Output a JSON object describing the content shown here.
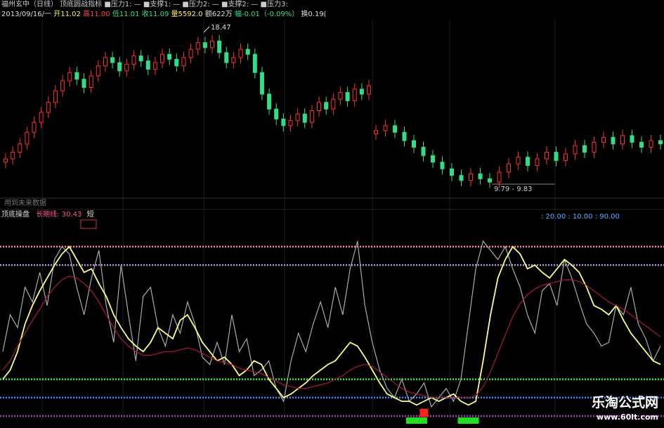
{
  "header": {
    "row1": "福州玄中（日线） 顶底圆战指标 ■压力1: — ■支撑1: — ■压力2: — ■支撑2: — ■压力3:",
    "row2": {
      "date": "2013/09/16/一",
      "open": "开11.02",
      "high": "高11.00",
      "low": "低11.01",
      "close": "收11.09",
      "volume": "量5592.0",
      "amount": "额622万",
      "change": "幅-0.01（-0.09%）",
      "turnover": "换0.19("
    }
  },
  "future_label": "用到未来数据",
  "indicator_header": {
    "name": "顶底操盘",
    "param_label": "长期线: 30.43",
    "short_label": "短",
    "levels_text": ": 20.00 : 10.00 : 90.00"
  },
  "colors": {
    "up": "#ff3030",
    "down": "#33dd88",
    "yellow": "#ffff88",
    "gray": "#aaaaaa",
    "maroon": "#aa1a3a",
    "pink": "#ff88aa",
    "lavender": "#bb99dd",
    "green": "#33ee33",
    "blue": "#4488ff",
    "purple": "#bb33cc"
  },
  "chart_data": [
    {
      "type": "candlestick",
      "annotations": [
        {
          "label": "18.47",
          "kind": "high"
        },
        {
          "label": "9.79 - 9.83",
          "kind": "range"
        }
      ],
      "segments": [
        {
          "name": "",
          "prices": [
            11.2,
            11.6,
            12.1,
            12.8,
            13.4,
            14.0,
            14.6,
            15.3,
            15.9,
            16.4,
            16.0,
            15.5,
            16.2,
            16.8,
            17.3,
            17.0,
            16.5,
            16.9,
            17.4,
            17.1,
            16.6,
            17.0,
            17.5,
            17.2,
            16.8,
            17.3,
            17.8,
            18.2,
            17.9,
            18.3,
            17.6,
            17.0,
            17.3,
            17.8,
            17.5,
            16.4,
            15.1,
            14.2,
            13.6,
            13.2,
            13.5,
            13.9,
            13.4,
            14.1,
            14.6,
            14.2,
            14.8,
            15.2,
            14.7,
            15.4,
            15.1,
            15.6
          ]
        },
        {
          "name": "",
          "prices": [
            12.9,
            13.2,
            12.8,
            12.3,
            11.9,
            11.4,
            11.0,
            10.6,
            10.2,
            9.9,
            10.3,
            10.0,
            9.8,
            10.4,
            10.9,
            11.3,
            10.8,
            11.2,
            11.6,
            11.1,
            11.5,
            12.0,
            11.6,
            12.2,
            12.5,
            12.1,
            12.6,
            12.2,
            11.9,
            12.3,
            12.1
          ]
        }
      ]
    },
    {
      "type": "line",
      "ylim": [
        0,
        100
      ],
      "hlines": [
        {
          "value": 92,
          "color": "#ff88aa"
        },
        {
          "value": 82,
          "color": "#bb99dd"
        },
        {
          "value": 20,
          "color": "#33ee33"
        },
        {
          "value": 10,
          "color": "#4488ff"
        },
        {
          "value": 0,
          "color": "#bb33cc"
        }
      ],
      "series": [
        {
          "name": "",
          "color": "#aaaaaa",
          "values": [
            35,
            55,
            48,
            70,
            62,
            78,
            60,
            85,
            92,
            88,
            70,
            55,
            75,
            90,
            60,
            40,
            82,
            55,
            30,
            65,
            70,
            48,
            38,
            55,
            45,
            62,
            50,
            32,
            28,
            40,
            28,
            55,
            35,
            42,
            22,
            25,
            30,
            15,
            8,
            30,
            45,
            35,
            50,
            62,
            48,
            70,
            55,
            80,
            95,
            60,
            40,
            25,
            15,
            10,
            20,
            8,
            12,
            18,
            5,
            10,
            15,
            8,
            20,
            50,
            80,
            95,
            90,
            85,
            92,
            80,
            70,
            55,
            45,
            68,
            72,
            60,
            85,
            75,
            62,
            50,
            45,
            38,
            40,
            60,
            55,
            70,
            50,
            42,
            30,
            38
          ]
        },
        {
          "name": "",
          "color": "#ffff88",
          "values": [
            20,
            25,
            35,
            50,
            60,
            68,
            75,
            82,
            88,
            92,
            85,
            78,
            80,
            72,
            65,
            55,
            48,
            42,
            38,
            35,
            40,
            48,
            45,
            42,
            52,
            55,
            48,
            40,
            35,
            30,
            32,
            28,
            22,
            25,
            30,
            28,
            20,
            15,
            10,
            12,
            15,
            18,
            22,
            25,
            28,
            30,
            35,
            40,
            38,
            32,
            25,
            18,
            12,
            10,
            8,
            8,
            6,
            8,
            10,
            8,
            10,
            12,
            8,
            6,
            8,
            30,
            55,
            75,
            85,
            92,
            88,
            80,
            82,
            78,
            75,
            80,
            85,
            82,
            78,
            70,
            60,
            58,
            55,
            60,
            52,
            45,
            40,
            35,
            30,
            28
          ]
        },
        {
          "name": "",
          "color": "#aa1a3a",
          "values": [
            25,
            30,
            38,
            45,
            52,
            58,
            65,
            70,
            74,
            76,
            75,
            72,
            68,
            62,
            55,
            48,
            42,
            38,
            35,
            33,
            33,
            34,
            35,
            35,
            36,
            37,
            36,
            34,
            32,
            30,
            29,
            28,
            26,
            25,
            24,
            23,
            21,
            19,
            17,
            16,
            15,
            15,
            16,
            17,
            18,
            20,
            22,
            25,
            27,
            28,
            27,
            24,
            21,
            18,
            15,
            13,
            12,
            11,
            10,
            10,
            10,
            10,
            10,
            10,
            11,
            16,
            24,
            34,
            44,
            54,
            61,
            66,
            69,
            71,
            72,
            73,
            74,
            74,
            73,
            71,
            68,
            65,
            62,
            60,
            58,
            55,
            52,
            49,
            46,
            43
          ]
        }
      ],
      "signals": [
        {
          "kind": "red",
          "index": 57
        },
        {
          "kind": "green",
          "index": 56
        },
        {
          "kind": "green",
          "index": 63
        }
      ]
    }
  ],
  "watermark": {
    "title": "乐淘公式网",
    "url": "www.60lt.com"
  }
}
